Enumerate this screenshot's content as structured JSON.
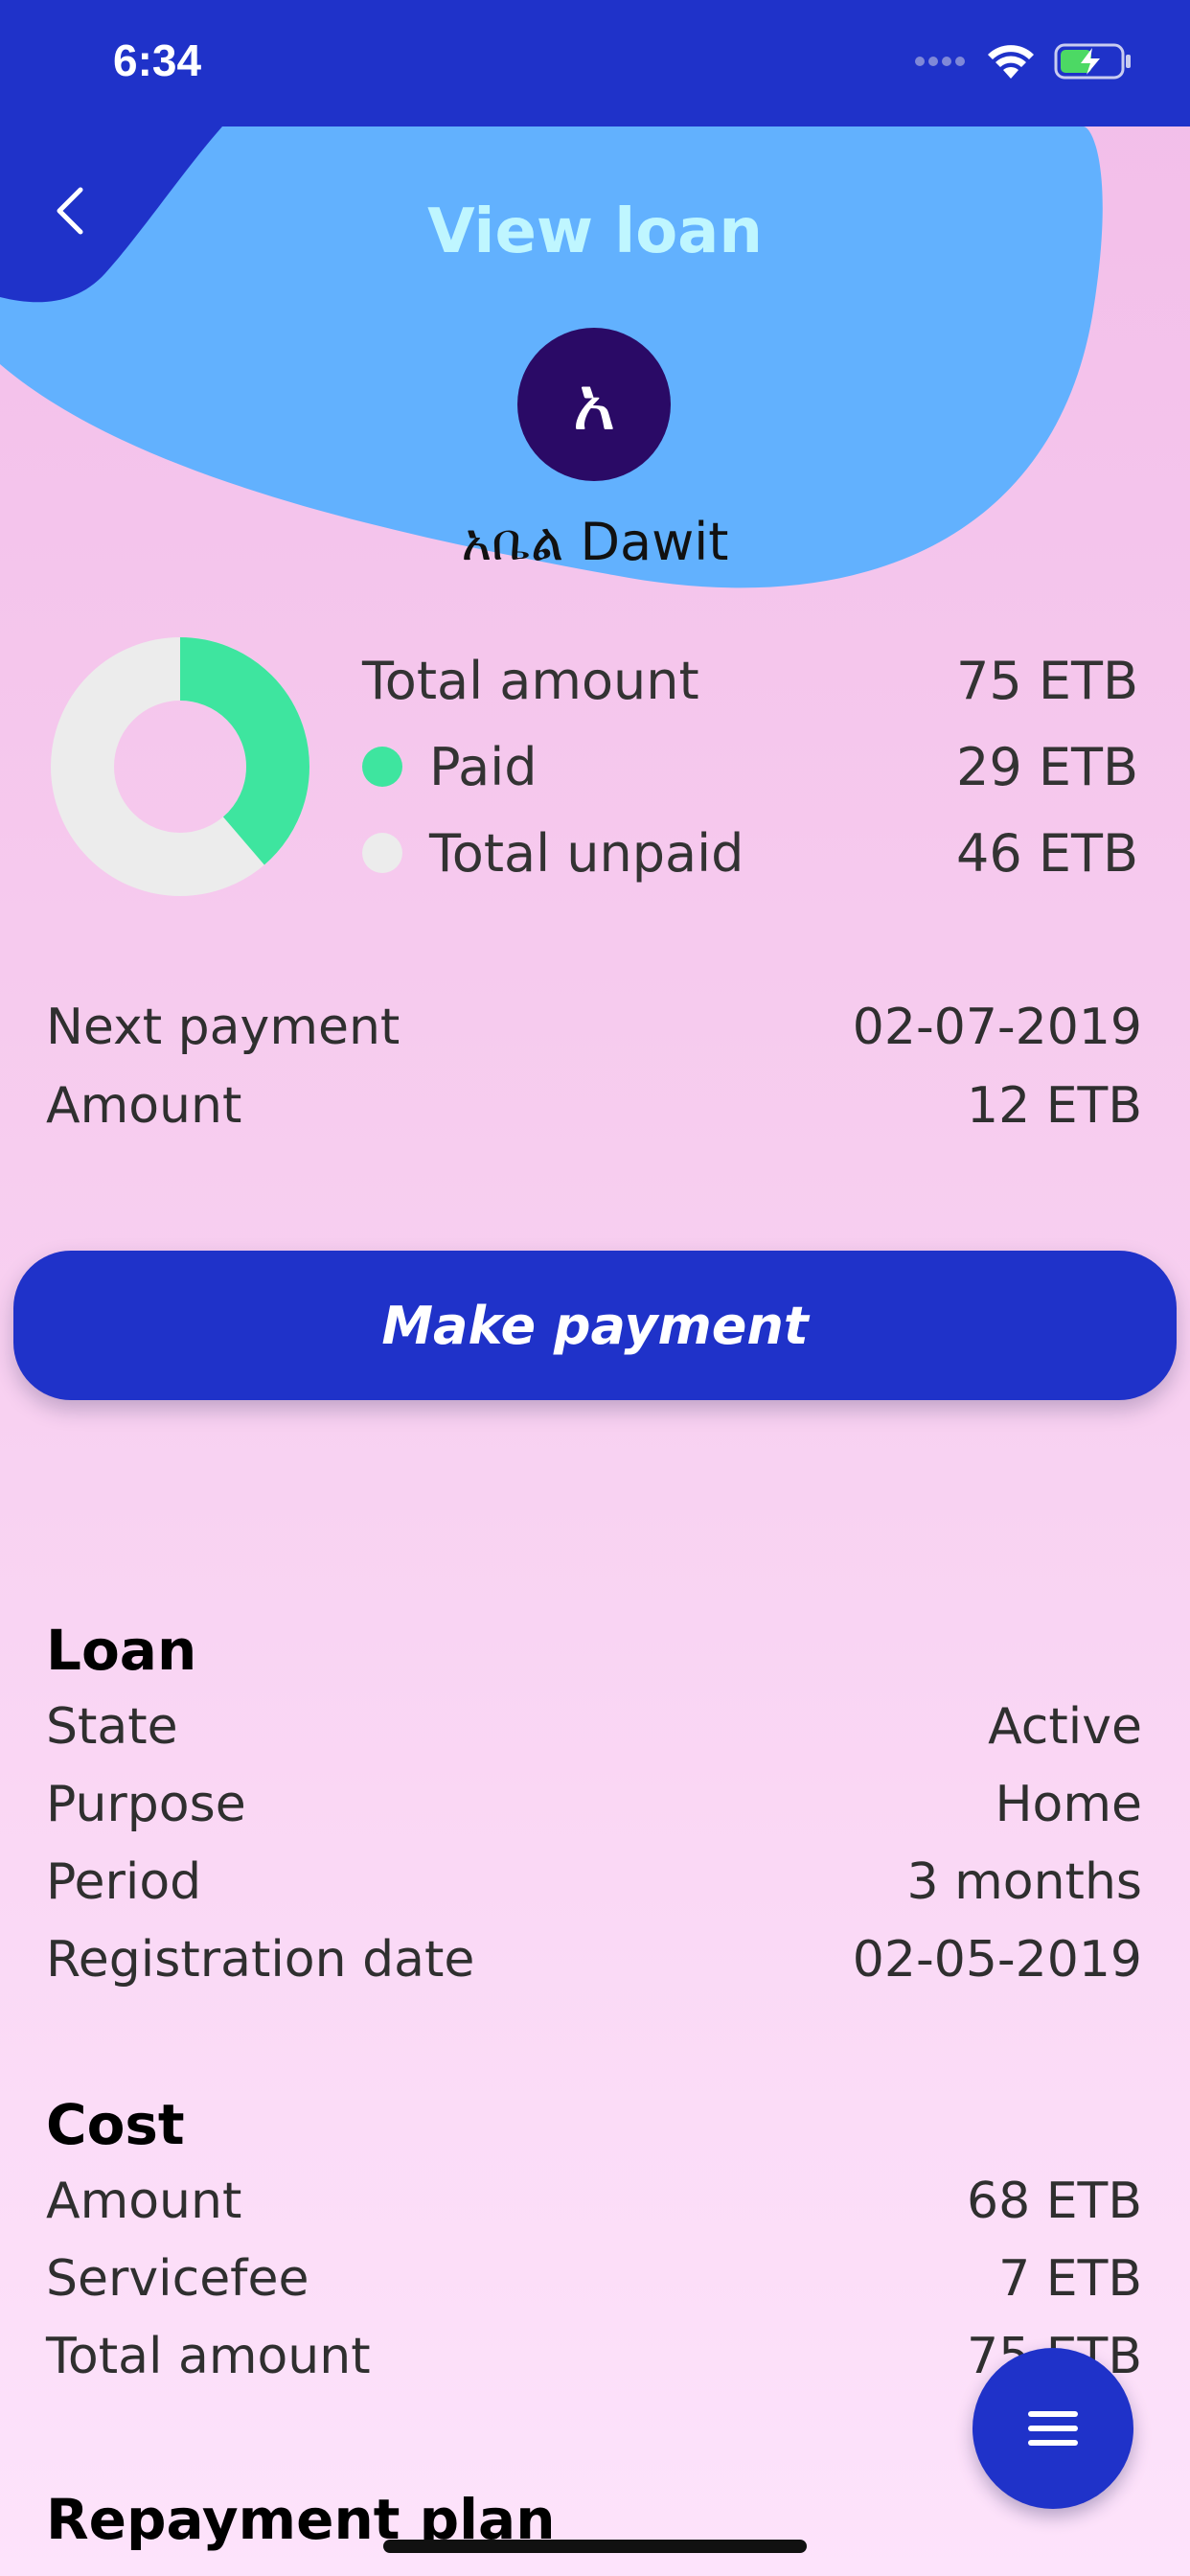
{
  "status_bar": {
    "time": "6:34"
  },
  "header": {
    "title": "View loan",
    "avatar_letter": "አ",
    "user_name": "አቤል Dawit"
  },
  "summary": {
    "total_label": "Total amount",
    "total_value": "75 ETB",
    "paid_label": "Paid",
    "paid_value": "29 ETB",
    "unpaid_label": "Total unpaid",
    "unpaid_value": "46 ETB",
    "paid_fraction": 0.387
  },
  "next_payment": {
    "date_label": "Next payment",
    "date_value": "02-07-2019",
    "amount_label": "Amount",
    "amount_value": "12 ETB"
  },
  "action": {
    "make_payment": "Make payment"
  },
  "loan": {
    "title": "Loan",
    "rows": [
      {
        "label": "State",
        "value": "Active"
      },
      {
        "label": "Purpose",
        "value": "Home"
      },
      {
        "label": "Period",
        "value": "3 months"
      },
      {
        "label": "Registration date",
        "value": "02-05-2019"
      }
    ]
  },
  "cost": {
    "title": "Cost",
    "rows": [
      {
        "label": "Amount",
        "value": "68 ETB"
      },
      {
        "label": "Servicefee",
        "value": "7 ETB"
      },
      {
        "label": "Total amount",
        "value": "75 ETB"
      }
    ]
  },
  "repayment": {
    "title": "Repayment plan"
  },
  "colors": {
    "primary": "#1f32c9",
    "blob": "#62b1fe",
    "paid": "#3ee59f",
    "unpaid": "#ececec",
    "avatar": "#2a0a66",
    "title": "#bff6ff"
  },
  "icons": {
    "back": "chevron-left-icon",
    "menu": "menu-icon",
    "wifi": "wifi-icon",
    "battery": "battery-charging-icon",
    "signal": "signal-icon"
  }
}
